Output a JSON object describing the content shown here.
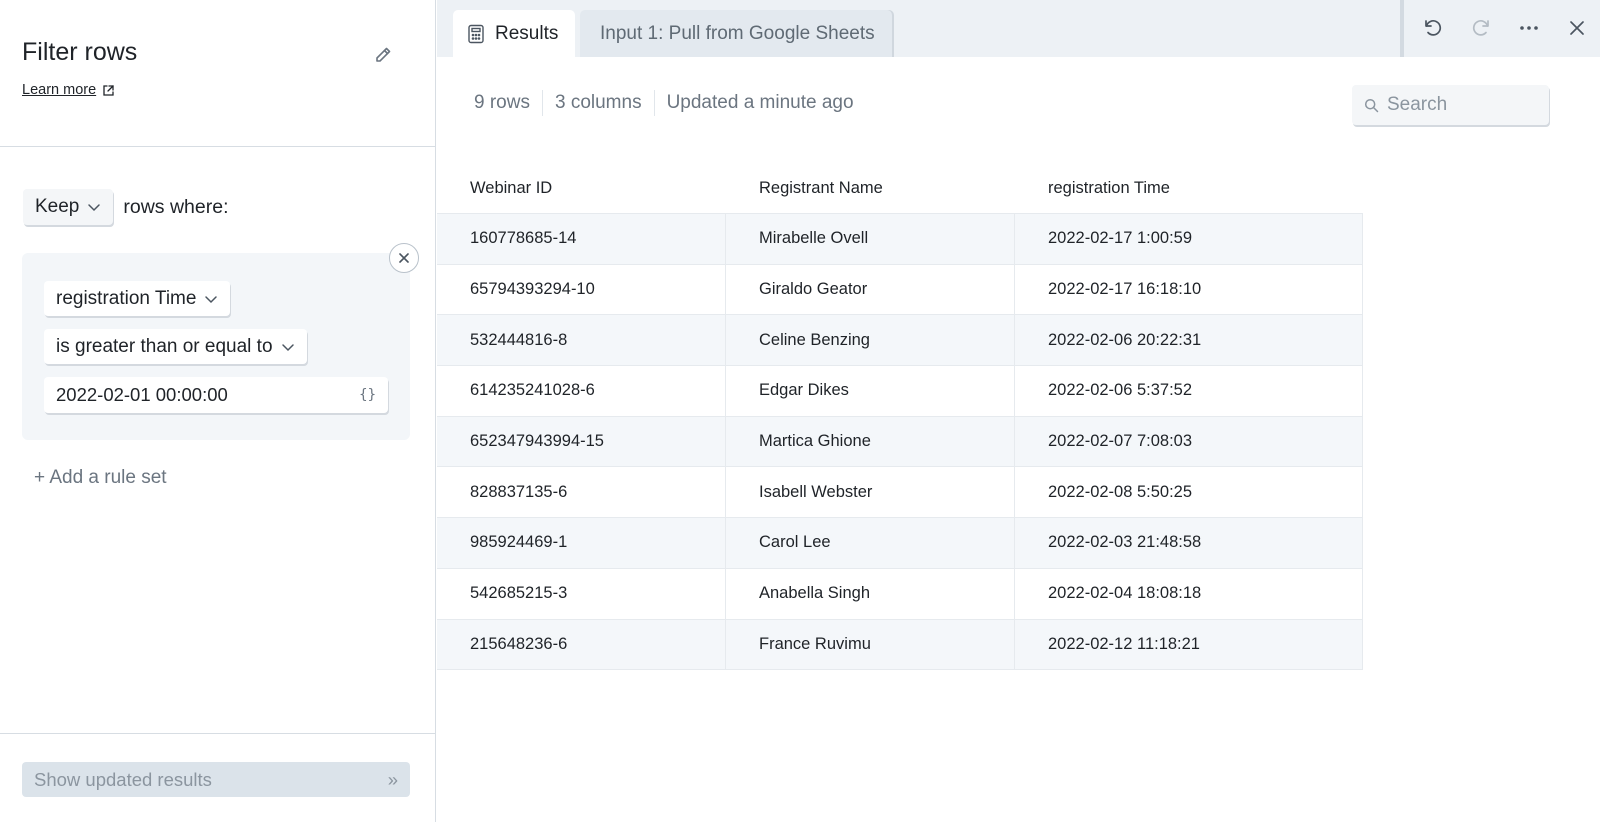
{
  "left_panel": {
    "title": "Filter rows",
    "learn_more": "Learn more",
    "keep_label": "Keep",
    "rows_where": "rows where:",
    "rule": {
      "field": "registration Time",
      "operator": "is greater than or equal to",
      "value": "2022-02-01 00:00:00",
      "variable_icon": "{}"
    },
    "add_rule_set": "+ Add a rule set",
    "show_button": "Show updated results",
    "show_button_icon": "»"
  },
  "tabs": [
    {
      "label": "Results",
      "icon": "calculator-icon",
      "active": true
    },
    {
      "label": "Input 1: Pull from Google Sheets",
      "active": false
    }
  ],
  "toolbar": {
    "undo": "undo-icon",
    "redo": "redo-icon",
    "more": "more-icon",
    "close": "close-icon"
  },
  "meta": {
    "rows": "9 rows",
    "columns": "3 columns",
    "updated": "Updated a minute ago"
  },
  "search": {
    "placeholder": "Search"
  },
  "table": {
    "headers": [
      "Webinar ID",
      "Registrant Name",
      "registration Time"
    ],
    "rows": [
      [
        "160778685-14",
        "Mirabelle Ovell",
        "2022-02-17 1:00:59"
      ],
      [
        "65794393294-10",
        "Giraldo Geator",
        "2022-02-17 16:18:10"
      ],
      [
        "532444816-8",
        "Celine Benzing",
        "2022-02-06 20:22:31"
      ],
      [
        "614235241028-6",
        "Edgar Dikes",
        "2022-02-06 5:37:52"
      ],
      [
        "652347943994-15",
        "Martica Ghione",
        "2022-02-07 7:08:03"
      ],
      [
        "828837135-6",
        "Isabell Webster",
        "2022-02-08 5:50:25"
      ],
      [
        "985924469-1",
        "Carol Lee",
        "2022-02-03 21:48:58"
      ],
      [
        "542685215-3",
        "Anabella Singh",
        "2022-02-04 18:08:18"
      ],
      [
        "215648236-6",
        "France Ruvimu",
        "2022-02-12 11:18:21"
      ]
    ]
  },
  "colors": {
    "accent_text": "#1f2328",
    "muted_text": "#6b7580",
    "panel_bg": "#f3f6f9",
    "tabbar_bg": "#edf1f5",
    "button_disabled_bg": "#dbe3ea"
  }
}
